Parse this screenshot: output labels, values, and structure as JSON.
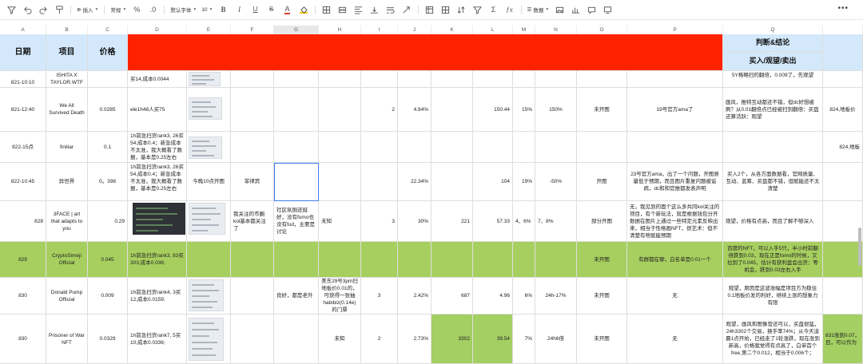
{
  "toolbar": {
    "insert_label": "插入",
    "format_label": "常规",
    "font_label": "默认字体",
    "size_label": "10",
    "data_label": "数据"
  },
  "columns": [
    "A",
    "B",
    "C",
    "D",
    "E",
    "F",
    "G",
    "H",
    "I",
    "J",
    "K",
    "L",
    "M",
    "N",
    "O",
    "P",
    "Q"
  ],
  "header": {
    "date": "日期",
    "project": "项目",
    "price": "价格",
    "judgement": "判断&结论",
    "decision": "买入/观望/卖出"
  },
  "rows": [
    {
      "date": "821-10:10",
      "project": "ISHITA X TAYLOR.WTF",
      "price": "",
      "d": "买14,成本0.0044",
      "f": "",
      "g": "",
      "h": "",
      "i": "",
      "j": "",
      "k": "",
      "l": "",
      "m": "",
      "n": "",
      "o": "",
      "p": "",
      "q": "5Y格略扫的翻倍，0.009了，先观望",
      "r": ""
    },
    {
      "date": "821-12:40",
      "project": "We All Survived Death",
      "price": "0.0285",
      "d": "ele1h48人买75",
      "f": "",
      "g": "",
      "h": "",
      "i": "2",
      "j": "4.84%",
      "k": "",
      "l": "150.44",
      "m": "15%",
      "n": "150%",
      "o": "未开图",
      "p": "19号官方ama了",
      "q": "画风，推特互动都还不错，但dc好想被刷？从0.01翻倍点已经被扫到翻倍：买盘还算活跃：观望",
      "r": "824,地板价"
    },
    {
      "date": "822-15点",
      "project": "finiliar",
      "price": "0.1",
      "d": "1h前急扫货rank3, 26买54,成本0.4；新急成本不太准，我大概看了数据，基本是0.25左右",
      "f": "",
      "g": "",
      "h": "",
      "i": "",
      "j": "",
      "k": "",
      "l": "",
      "m": "",
      "n": "",
      "o": "",
      "p": "",
      "q": "",
      "r": "824,地板"
    },
    {
      "date": "822-10:45",
      "project": "异世界",
      "price": "0。398",
      "d": "1h前急扫货rank3, 26买54,成本0.4；新急成本不太准，我大概看了数据，基本是0.25左右",
      "e": "今晚10点开图",
      "f": "菲律宾",
      "g": "",
      "h": "",
      "i": "",
      "j": "22.34%",
      "k": "",
      "l": "104",
      "m": "19%",
      "n": "-50%",
      "o": "开图",
      "p": "23号官方ama，出了一个问题，开图质量低于预期，而且图片重复问题被诟病，dc和和官推都发表声明",
      "q": "买入2个，从各方面数据看，官网质量、互动、蓝筹、买盘都不错，但赋能还不太清楚",
      "r": ""
    },
    {
      "date": "828",
      "project": "3FACE | art that adapts to you",
      "price": "0.29",
      "d": "",
      "f": "我关注的币圈kol基本都关注了",
      "g": "社区氛围还挺好，没有fomo也没有fud，主要是讨论",
      "h": "未知",
      "i": "3",
      "j": "30%",
      "k": "221",
      "l": "57.33",
      "m": "4、6%",
      "n": "7、8%",
      "o": "部分开图",
      "p": "无，我见到的面个这么多共同kol关注的项目，有个新玩法，就是根据钱包分开数据在图片上通过一些特定元素反映出来，相当于性格画NFT，很艺术：但不清楚有啥赋能预期",
      "q": "观望，价格有点高，而且了解不够深入",
      "r": ""
    },
    {
      "date": "829",
      "project": "CryptoSimeji Official",
      "price": "0.045",
      "d": "1h前急扫货rank3, 83买303,成本0.036;",
      "f": "",
      "g": "",
      "h": "",
      "i": "",
      "j": "",
      "k": "",
      "l": "",
      "m": "",
      "n": "",
      "o": "未开图",
      "p": "有群都在聊，白名单是0.01一个",
      "q": "百度的NFT，可以入手5只，半小时前翻倍跌到0.03，现在正是fomo的时候，又拉到了0.045，估计有获利盘会出货：等机会，跌到0.03左右入手",
      "r": ""
    },
    {
      "date": "830",
      "project": "Donald Pump Official",
      "price": "0.009",
      "d": "1h前急扫货rank4, 3买12,成本0.0159;",
      "f": "",
      "g": "良好，都是老外",
      "h": "美东29号3pm扫地板价0.01的，可获得一张抽habibiz(0.14e)的门票",
      "i": "3",
      "j": "2.42%",
      "k": "687",
      "l": "4.96",
      "m": "6%",
      "n": "24h-17%",
      "o": "未开图",
      "p": "无",
      "q": "观望，原因是这波涨幅是项目方为稳住0.1地板价发的利好，继续上涨的想象力有限",
      "r": ""
    },
    {
      "date": "830",
      "project": "Prisoner of War NFT",
      "price": "0.0329",
      "d": "1h前急扫货rank7, 5买10,成本0.0336;",
      "f": "",
      "g": "",
      "h": "未知",
      "i": "2",
      "j": "2.73%",
      "k": "3302",
      "l": "39.54",
      "m": "7%",
      "n": "24h6倍",
      "o": "未开图",
      "p": "无",
      "q": "观望，画风和图像营还可以，买盘很猛，24h3302个交易，换手率74%；从今天凌晨1点开始，已经走了1轮涨跌，现在涨到新高，价格我觉得有点高了，白单首个free,第二个0.012，相当于0.006个；",
      "r": "831涨到0.07，目，可以作为"
    }
  ]
}
